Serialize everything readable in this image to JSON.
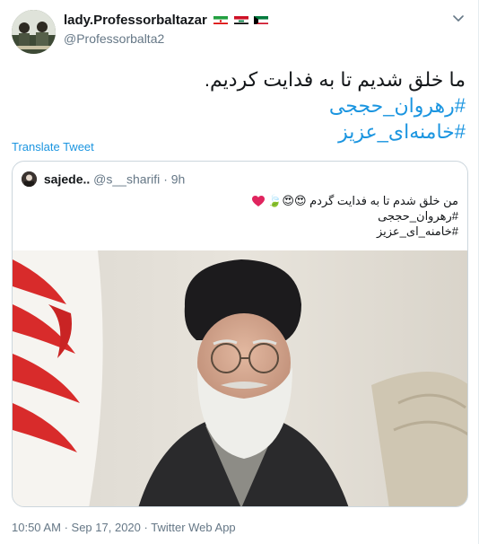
{
  "author": {
    "display_name": "lady.Professorbaltazar",
    "handle": "@Professorbalta2",
    "flag_icons": [
      "iran-flag-icon",
      "iraq-flag-icon",
      "kuwait-flag-icon"
    ]
  },
  "tweet": {
    "text_line": "ما خلق شدیم تا به فدایت کردیم.",
    "hashtags": [
      "#رهروان_حججی",
      "#خامنه‌ای_عزیز"
    ],
    "translate_label": "Translate Tweet"
  },
  "quote": {
    "name": "sajede..",
    "handle": "@s__sharifi",
    "dot": "·",
    "time": "9h",
    "text_line": "من خلق شدم تا به فدایت گردم 😍😍🍃",
    "emoji_heart_icon": "red-heart-icon",
    "hashtags": [
      "#رهروان_حججی",
      "#خامنه_ای_عزیز"
    ],
    "image_icon": "photo-portrait"
  },
  "footer": {
    "time": "10:50 AM",
    "dot1": "·",
    "date": "Sep 17, 2020",
    "dot2": "·",
    "source": "Twitter Web App"
  },
  "colors": {
    "link": "#1b95e0",
    "secondary": "#657786",
    "border": "#ccd6dd"
  }
}
